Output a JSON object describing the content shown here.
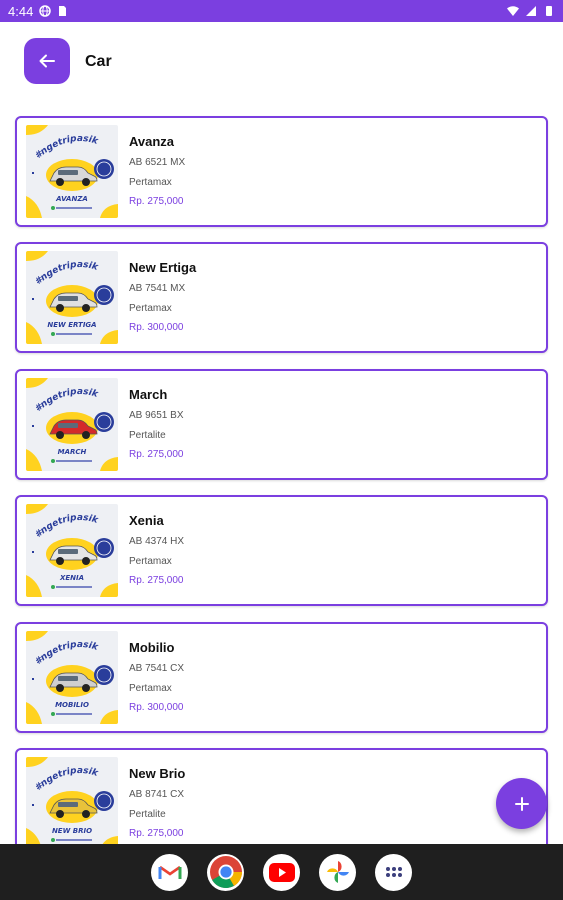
{
  "status_bar": {
    "time": "4:44"
  },
  "app_bar": {
    "title": "Car"
  },
  "cars": [
    {
      "name": "Avanza",
      "plate": "AB 6521 MX",
      "fuel": "Pertamax",
      "price": "Rp. 275,000",
      "badge": "AVANZA",
      "car_color": "#d8d8d8"
    },
    {
      "name": "New Ertiga",
      "plate": "AB 7541 MX",
      "fuel": "Pertamax",
      "price": "Rp. 300,000",
      "badge": "NEW ERTIGA",
      "car_color": "#e0e0e0"
    },
    {
      "name": "March",
      "plate": "AB 9651 BX",
      "fuel": "Pertalite",
      "price": "Rp. 275,000",
      "badge": "MARCH",
      "car_color": "#d42a2a"
    },
    {
      "name": "Xenia",
      "plate": "AB 4374 HX",
      "fuel": "Pertamax",
      "price": "Rp. 275,000",
      "badge": "XENIA",
      "car_color": "#e6e6e6"
    },
    {
      "name": "Mobilio",
      "plate": "AB 7541 CX",
      "fuel": "Pertamax",
      "price": "Rp. 300,000",
      "badge": "MOBILIO",
      "car_color": "#cfcfcf"
    },
    {
      "name": "New Brio",
      "plate": "AB 8741 CX",
      "fuel": "Pertalite",
      "price": "Rp. 275,000",
      "badge": "NEW BRIO",
      "car_color": "#e8c23a"
    }
  ],
  "thumb_text": {
    "headline": "#ngetripasik"
  },
  "colors": {
    "accent": "#7b3fe0",
    "yellow": "#ffd21f",
    "nav_bg": "#1f1f1f"
  },
  "icons": {
    "back": "arrow-left-icon",
    "fab": "plus-icon",
    "dock": [
      "gmail-icon",
      "chrome-icon",
      "youtube-icon",
      "photos-icon",
      "app-drawer-icon"
    ]
  }
}
